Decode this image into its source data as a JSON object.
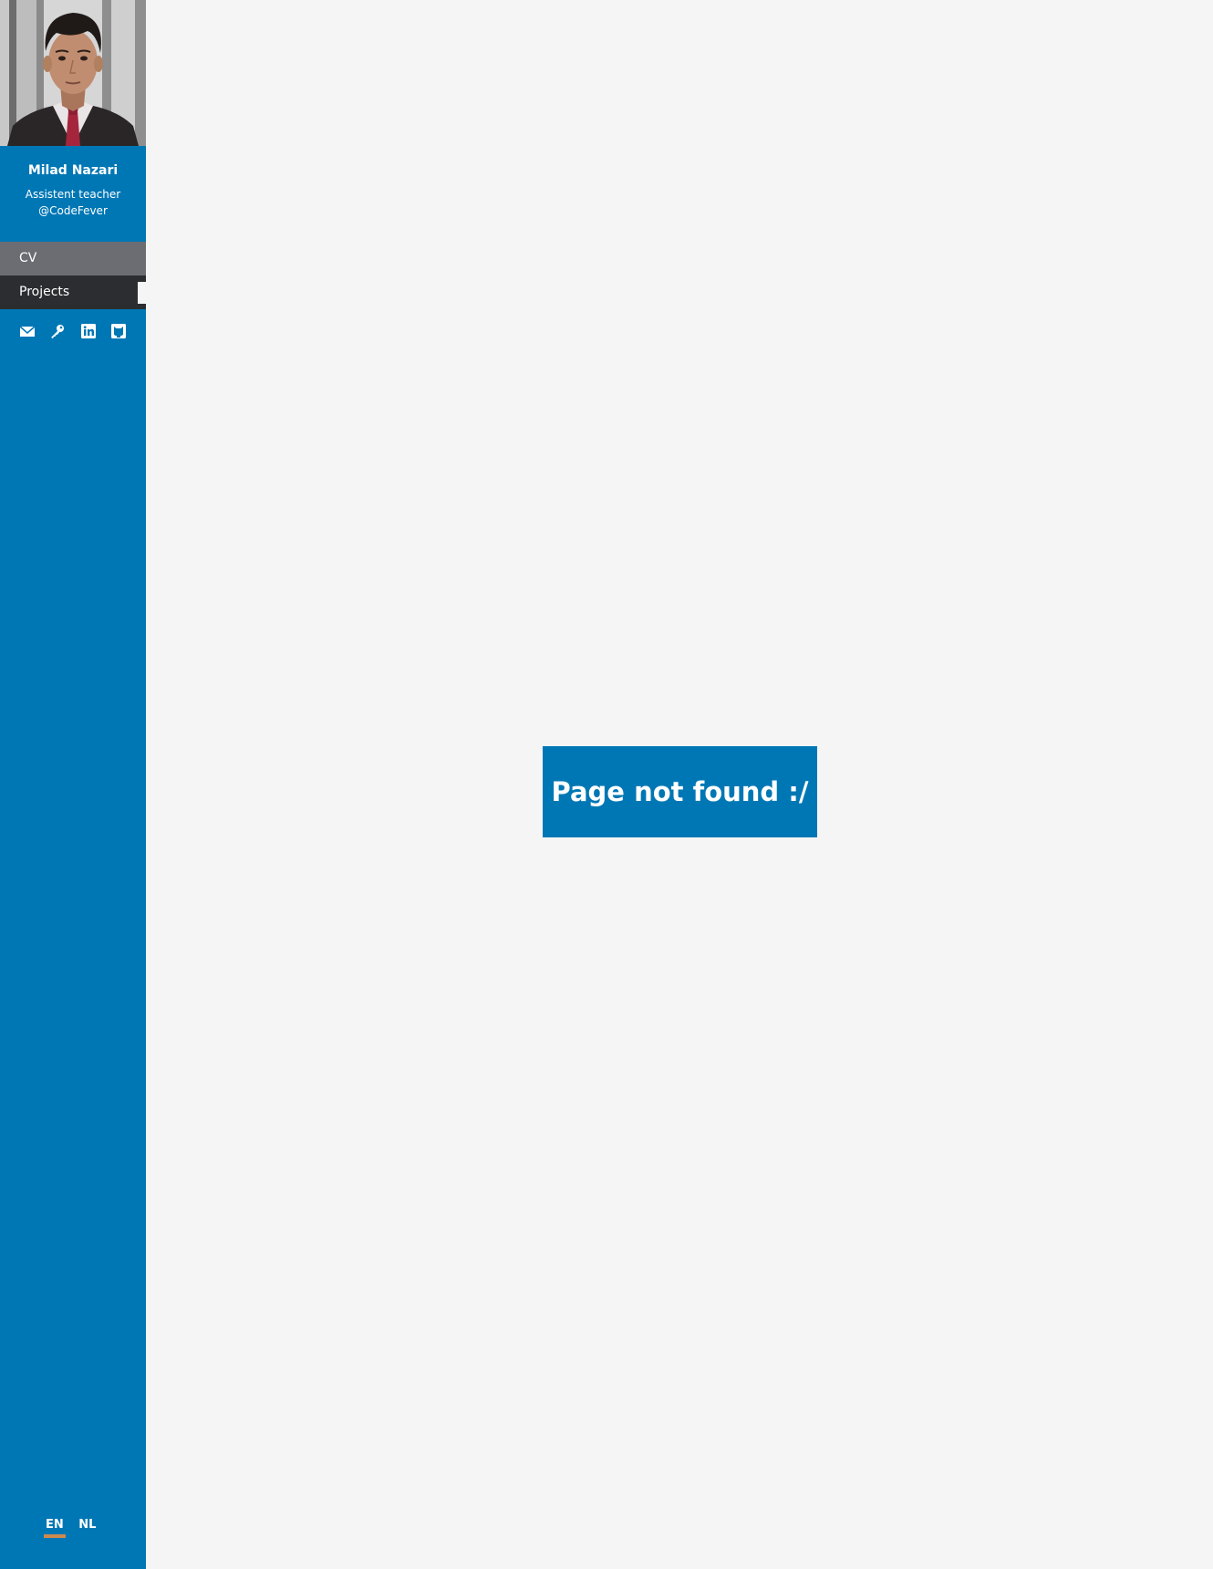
{
  "profile": {
    "name": "Milad Nazari",
    "role_line1": "Assistent teacher",
    "role_line2": "@CodeFever"
  },
  "nav": {
    "items": [
      {
        "label": "CV"
      },
      {
        "label": "Projects"
      }
    ]
  },
  "social": {
    "icons": [
      "mail-icon",
      "key-icon",
      "linkedin-icon",
      "github-icon"
    ]
  },
  "language": {
    "options": [
      "EN",
      "NL"
    ],
    "active": "EN"
  },
  "main": {
    "message": "Page not found :/"
  },
  "colors": {
    "sidebar": "#0077b5",
    "nav_cv": "#6b6d72",
    "nav_projects": "#2b2d31",
    "background": "#f5f5f5",
    "lang_underline": "#cc8a4e"
  }
}
